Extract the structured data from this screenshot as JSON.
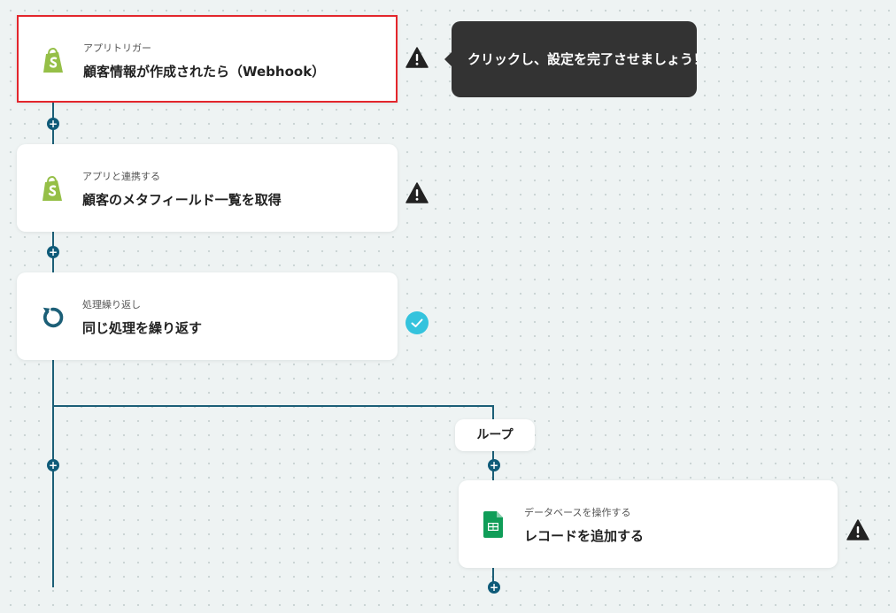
{
  "flow": {
    "steps": [
      {
        "sub": "アプリトリガー",
        "title": "顧客情報が作成されたら（Webhook）",
        "icon": "shopify-icon",
        "status": "warning"
      },
      {
        "sub": "アプリと連携する",
        "title": "顧客のメタフィールド一覧を取得",
        "icon": "shopify-icon",
        "status": "warning"
      },
      {
        "sub": "処理繰り返し",
        "title": "同じ処理を繰り返す",
        "icon": "loop-icon",
        "status": "complete"
      },
      {
        "sub": "データベースを操作する",
        "title": "レコードを追加する",
        "icon": "google-sheets-icon",
        "status": "warning"
      }
    ],
    "loop_label": "ループ",
    "add_symbol": "+"
  },
  "tooltip": {
    "text": "クリックし、設定を完了させましょう！"
  },
  "colors": {
    "connector": "#1c5f77",
    "add_button": "#0f5b79",
    "selected_border": "#e3262c",
    "complete": "#34c3dd",
    "shopify_green": "#95bf47",
    "sheets_green": "#0f9d58",
    "tooltip_bg": "#333333"
  }
}
